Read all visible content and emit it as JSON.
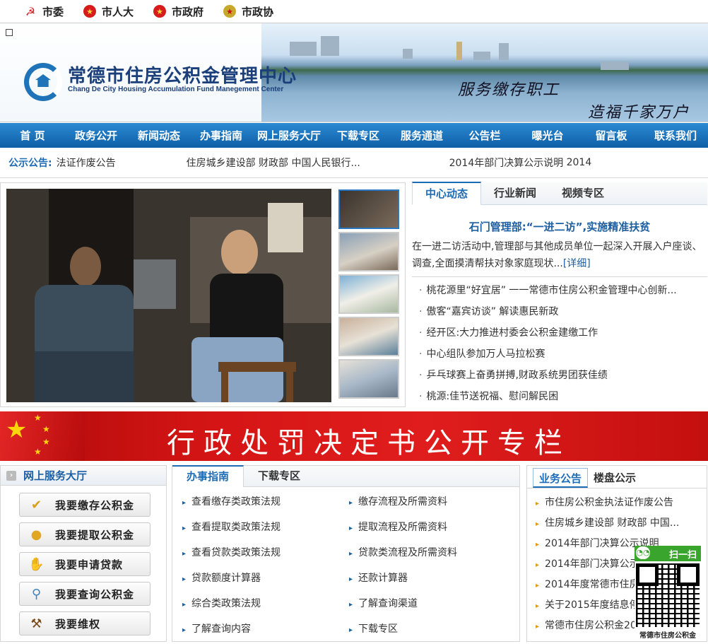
{
  "top_links": [
    {
      "label": "市委",
      "icon": "party-emblem-icon"
    },
    {
      "label": "市人大",
      "icon": "national-emblem-icon"
    },
    {
      "label": "市政府",
      "icon": "national-emblem-icon"
    },
    {
      "label": "市政协",
      "icon": "cppcc-emblem-icon"
    }
  ],
  "banner": {
    "title_cn": "常德市住房公积金管理中心",
    "title_en": "Chang De City Housing Accumulation Fund Manegement Center",
    "slogan1": "服务缴存职工",
    "slogan2": "造福千家万户"
  },
  "nav": [
    "首 页",
    "政务公开",
    "新闻动态",
    "办事指南",
    "网上服务大厅",
    "下载专区",
    "服务通道",
    "公告栏",
    "曝光台",
    "留言板",
    "联系我们"
  ],
  "notice_bar": {
    "label": "公示公告:",
    "items": [
      "法证作废公告",
      "住房城乡建设部 财政部 中国人民银行...",
      "2014年部门决算公示说明",
      "2014"
    ]
  },
  "news": {
    "tabs": [
      "中心动态",
      "行业新闻",
      "视频专区"
    ],
    "headline": "石门管理部:“一进二访”,实施精准扶贫",
    "summary": "在一进二访活动中,管理部与其他成员单位一起深入开展入户座谈、调查,全面摸清帮扶对象家庭现状...",
    "more": "[详细]",
    "items": [
      "桃花源里“好宜居” 一一常德市住房公积金管理中心创新...",
      "傲客“嘉宾访谈” 解读惠民新政",
      "经开区:大力推进村委会公积金建缴工作",
      "中心组队参加万人马拉松赛",
      "乒乓球赛上奋勇拼搏,财政系统男团获佳绩",
      "桃源:佳节送祝福、慰问解民困"
    ]
  },
  "red_banner": {
    "text": "行政处罚决定书公开专栏"
  },
  "service_hall": {
    "title": "网上服务大厅",
    "buttons": [
      {
        "label": "我要缴存公积金",
        "icon": "medal-icon"
      },
      {
        "label": "我要提取公积金",
        "icon": "coins-icon"
      },
      {
        "label": "我要申请贷款",
        "icon": "handshake-icon"
      },
      {
        "label": "我要查询公积金",
        "icon": "magnifier-icon"
      },
      {
        "label": "我要维权",
        "icon": "gavel-icon"
      }
    ]
  },
  "guide": {
    "tabs": [
      "办事指南",
      "下载专区"
    ],
    "items": [
      "查看缴存类政策法规",
      "缴存流程及所需资料",
      "查看提取类政策法规",
      "提取流程及所需资料",
      "查看贷款类政策法规",
      "贷款类流程及所需资料",
      "贷款额度计算器",
      "还款计算器",
      "综合类政策法规",
      "了解查询渠道",
      "了解查询内容",
      "下载专区"
    ]
  },
  "announcements": {
    "tabs": [
      "业务公告",
      "楼盘公示"
    ],
    "items": [
      "市住房公积金执法证作废公告",
      "住房城乡建设部 财政部 中国...",
      "2014年部门决算公示说明",
      "2014年部门决算公示",
      "2014年度常德市住房",
      "关于2015年度结息停",
      "常德市住房公积金20"
    ]
  },
  "qr_widget": {
    "scan_label": "扫一扫",
    "caption": "常德市住房公积金"
  },
  "colors": {
    "nav_blue": "#0e5fa6",
    "accent_blue": "#1c6cb8",
    "banner_red": "#d51515"
  }
}
